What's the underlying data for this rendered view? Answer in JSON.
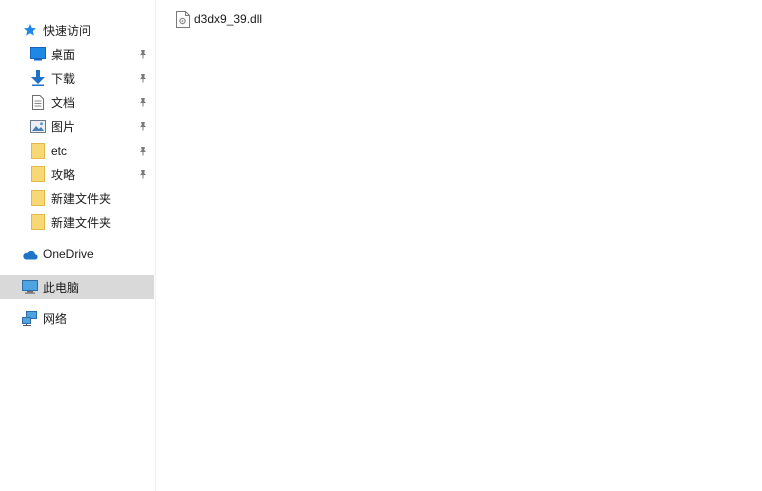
{
  "nav": {
    "quick_access": {
      "label": "快速访问",
      "icon": "star-icon"
    },
    "pinned": [
      {
        "label": "桌面",
        "icon": "desktop-icon",
        "pinned": true
      },
      {
        "label": "下载",
        "icon": "download-arrow-icon",
        "pinned": true
      },
      {
        "label": "文档",
        "icon": "document-icon",
        "pinned": true
      },
      {
        "label": "图片",
        "icon": "picture-icon",
        "pinned": true
      },
      {
        "label": "etc",
        "icon": "folder-icon",
        "pinned": true
      },
      {
        "label": "攻略",
        "icon": "folder-icon",
        "pinned": true
      },
      {
        "label": "新建文件夹",
        "icon": "folder-icon",
        "pinned": false
      },
      {
        "label": "新建文件夹",
        "icon": "folder-icon",
        "pinned": false
      }
    ],
    "onedrive": {
      "label": "OneDrive",
      "icon": "cloud-icon"
    },
    "this_pc": {
      "label": "此电脑",
      "icon": "computer-icon",
      "selected": true
    },
    "network": {
      "label": "网络",
      "icon": "network-icon"
    }
  },
  "content": {
    "files": [
      {
        "name": "d3dx9_39.dll",
        "icon": "dll-file-icon"
      }
    ]
  },
  "colors": {
    "selected_bg": "#d9d9d9",
    "folder": "#f8d775",
    "accent": "#1e73c8"
  }
}
